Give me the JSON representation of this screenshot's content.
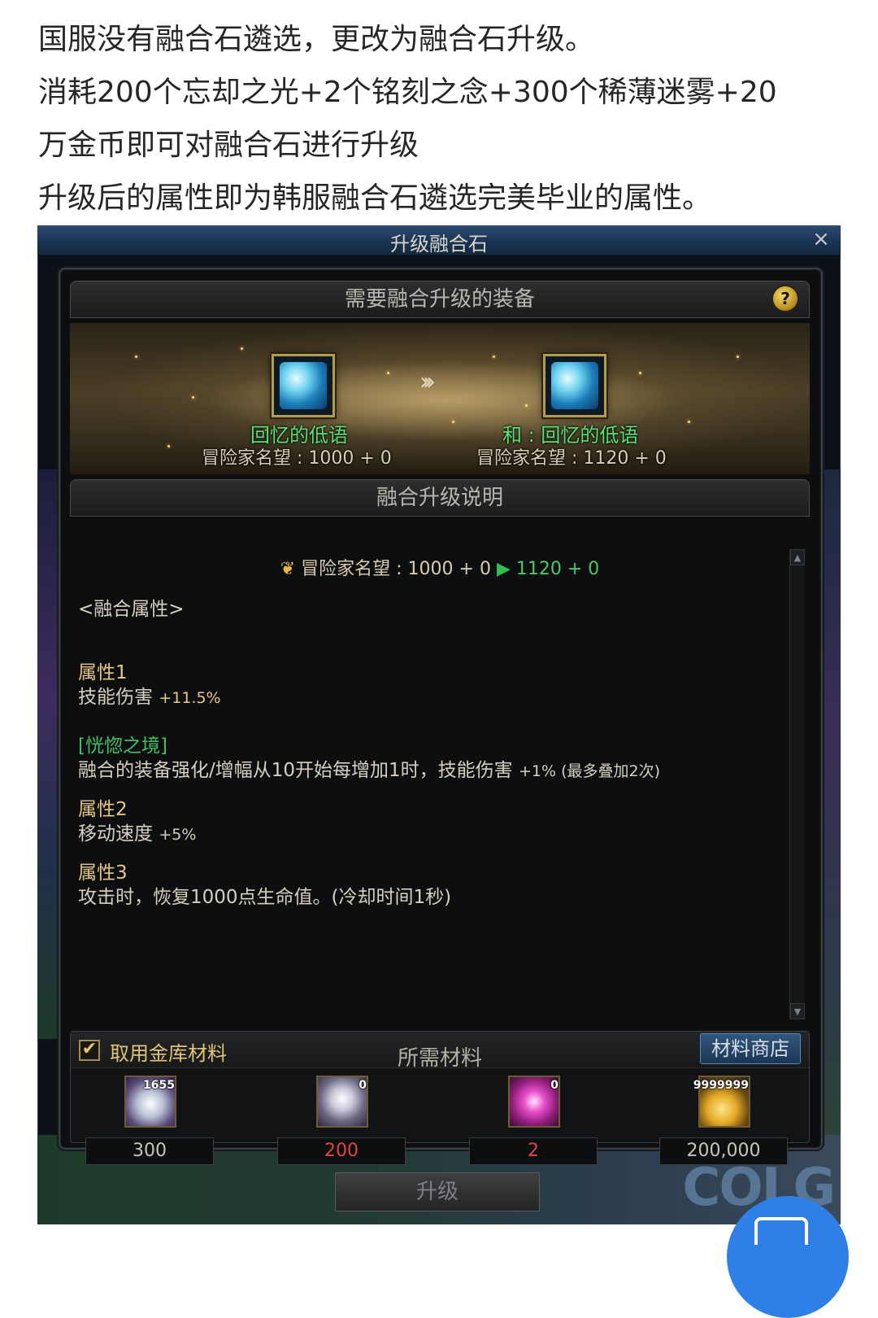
{
  "intro": {
    "line1": "国服没有融合石遴选，更改为融合石升级。",
    "line2": "消耗200个忘却之光+2个铭刻之念+300个稀薄迷雾+20",
    "line3": "万金币即可对融合石进行升级",
    "line4": "升级后的属性即为韩服融合石遴选完美毕业的属性。"
  },
  "window": {
    "title": "升级融合石",
    "close": "×",
    "section_equip": "需要融合升级的装备",
    "help": "?",
    "arrows": "›››",
    "from": {
      "name": "回忆的低语",
      "fame": "冒险家名望 : 1000 + 0"
    },
    "to": {
      "name": "和 : 回忆的低语",
      "fame": "冒险家名望 : 1120 + 0"
    },
    "section_desc": "融合升级说明",
    "fame_summary": {
      "icon": "❦",
      "label": "冒险家名望 : 1000 + 0",
      "arrow": "▶",
      "new_value": "1120 + 0"
    },
    "desc": {
      "fusion_attr": "<融合属性>",
      "attr1_title": "属性1",
      "attr1_text": "技能伤害",
      "attr1_value": "+11.5%",
      "set_name": "[恍惚之境]",
      "set_text": "融合的装备强化/增幅从10开始每增加1时，技能伤害",
      "set_value": "+1% (最多叠加2次)",
      "attr2_title": "属性2",
      "attr2_text": "移动速度",
      "attr2_value": "+5%",
      "attr3_title": "属性3",
      "attr3_text": "攻击时，恢复1000点生命值。(冷却时间1秒)"
    },
    "materials": {
      "use_vault": "取用金库材料",
      "checked": "✔",
      "title": "所需材料",
      "shop": "材料商店",
      "items": [
        {
          "icon": "mist-icon",
          "owned": "1655",
          "need": "300"
        },
        {
          "icon": "light-icon",
          "owned": "0",
          "need": "200"
        },
        {
          "icon": "inscription-icon",
          "owned": "0",
          "need": "2"
        },
        {
          "icon": "gold-icon",
          "owned": "9999999",
          "need": "200,000"
        }
      ]
    },
    "upgrade": "升级",
    "watermark": "COLG"
  }
}
